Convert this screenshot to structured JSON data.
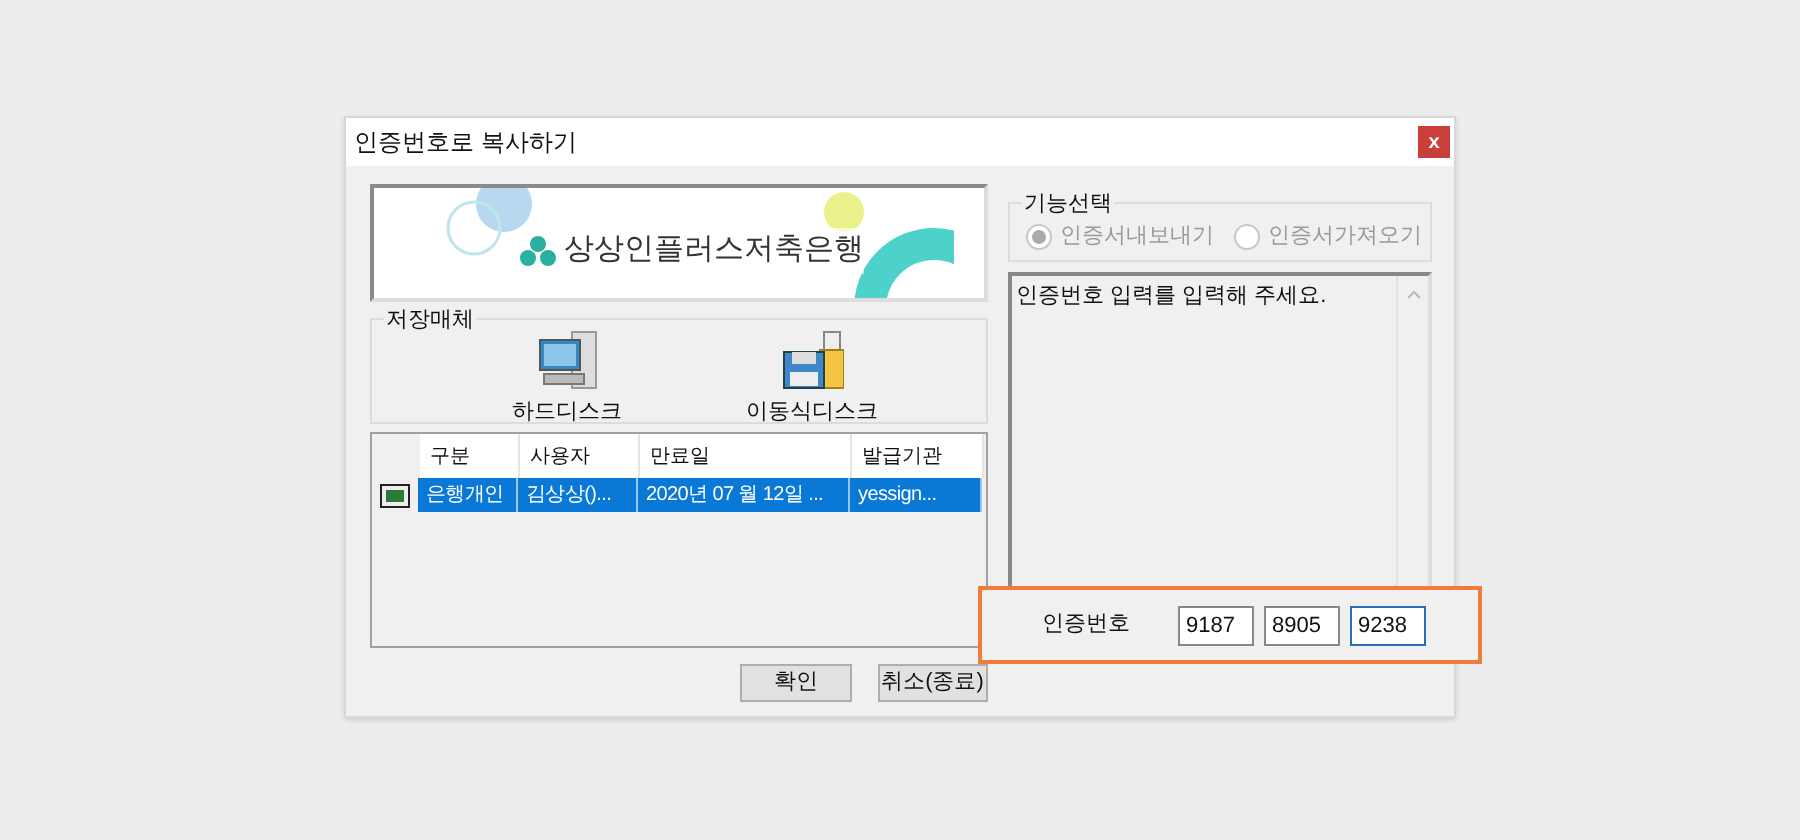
{
  "window": {
    "title": "인증번호로 복사하기",
    "close": "x"
  },
  "banner": {
    "bank_name": "상상인플러스저축은행"
  },
  "storage": {
    "legend": "저장매체",
    "devices": [
      {
        "kind": "harddisk",
        "label": "하드디스크"
      },
      {
        "kind": "removable",
        "label": "이동식디스크"
      }
    ]
  },
  "cert_table": {
    "columns": [
      "구분",
      "사용자",
      "만료일",
      "발급기관"
    ],
    "rows": [
      {
        "selected": true,
        "cells": [
          "은행개인",
          "김상상()...",
          "2020년 07 월 12일 ...",
          "yessign..."
        ]
      }
    ]
  },
  "function_select": {
    "legend": "기능선택",
    "options": [
      {
        "label": "인증서내보내기",
        "selected": true,
        "disabled": true
      },
      {
        "label": "인증서가져오기",
        "selected": false,
        "disabled": true
      }
    ]
  },
  "message": "인증번호 입력를 입력해 주세요.",
  "auth_code": {
    "label": "인증번호",
    "values": [
      "9187",
      "8905",
      "9238"
    ]
  },
  "buttons": [
    "확인",
    "취소(종료)"
  ]
}
